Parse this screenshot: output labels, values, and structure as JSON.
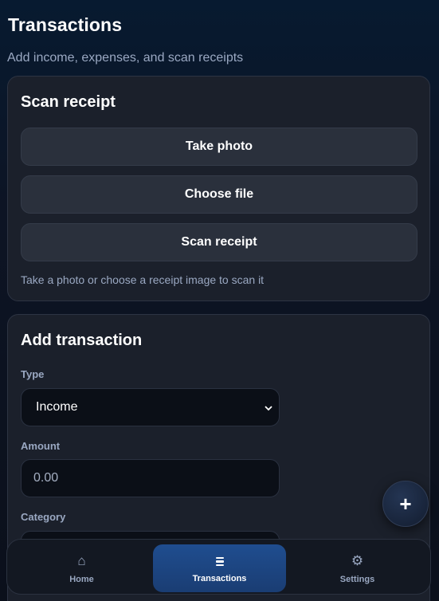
{
  "header": {
    "title": "Transactions",
    "subtitle": "Add income, expenses, and scan receipts"
  },
  "scan_card": {
    "title": "Scan receipt",
    "take_photo_label": "Take photo",
    "choose_file_label": "Choose file",
    "scan_receipt_label": "Scan receipt",
    "hint": "Take a photo or choose a receipt image to scan it"
  },
  "add_card": {
    "title": "Add transaction",
    "type_label": "Type",
    "type_value": "Income",
    "amount_label": "Amount",
    "amount_placeholder": "0.00",
    "category_label": "Category"
  },
  "fab": {
    "label": "+"
  },
  "nav": {
    "items": [
      {
        "label": "Home",
        "icon": "home-icon",
        "glyph": "⌂",
        "active": false
      },
      {
        "label": "Transactions",
        "icon": "list-icon",
        "active": true
      },
      {
        "label": "Settings",
        "icon": "gear-icon",
        "glyph": "⚙",
        "active": false
      }
    ]
  },
  "colors": {
    "accent": "#1f4d8f",
    "card": "#1b202b",
    "background": "#0d1424"
  }
}
